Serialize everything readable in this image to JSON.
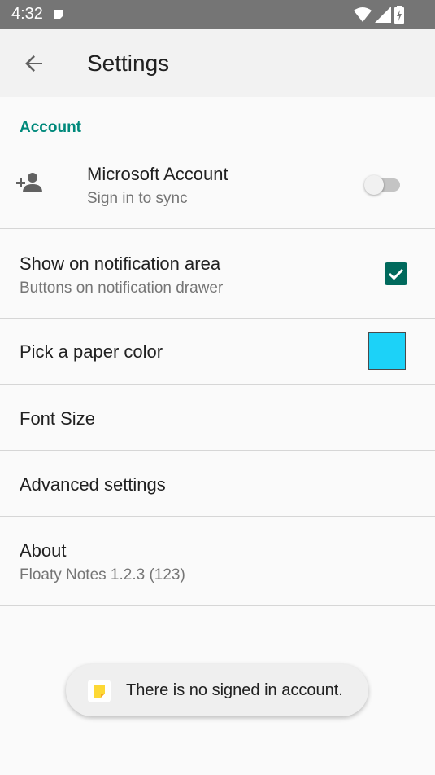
{
  "status_bar": {
    "time": "4:32",
    "icons": [
      "notes-notification-icon",
      "wifi-icon",
      "cell-signal-icon",
      "battery-charging-icon"
    ]
  },
  "app_bar": {
    "title": "Settings",
    "back_icon": "arrow-back-icon"
  },
  "account_section": {
    "title": "Account",
    "microsoft_account": {
      "label": "Microsoft Account",
      "summary": "Sign in to sync",
      "icon": "person-add-icon",
      "enabled": false
    }
  },
  "settings": {
    "notification": {
      "label": "Show on notification area",
      "summary": "Buttons on notification drawer",
      "checked": true
    },
    "paper_color": {
      "label": "Pick a paper color",
      "color": "#1cd2f8"
    },
    "font_size": {
      "label": "Font Size"
    },
    "advanced": {
      "label": "Advanced settings"
    },
    "about": {
      "label": "About",
      "summary": "Floaty Notes 1.2.3 (123)"
    }
  },
  "toast": {
    "message": "There is no signed in account."
  },
  "colors": {
    "accent": "#00897b",
    "checkbox": "#00695c",
    "status_bar": "#757575"
  }
}
